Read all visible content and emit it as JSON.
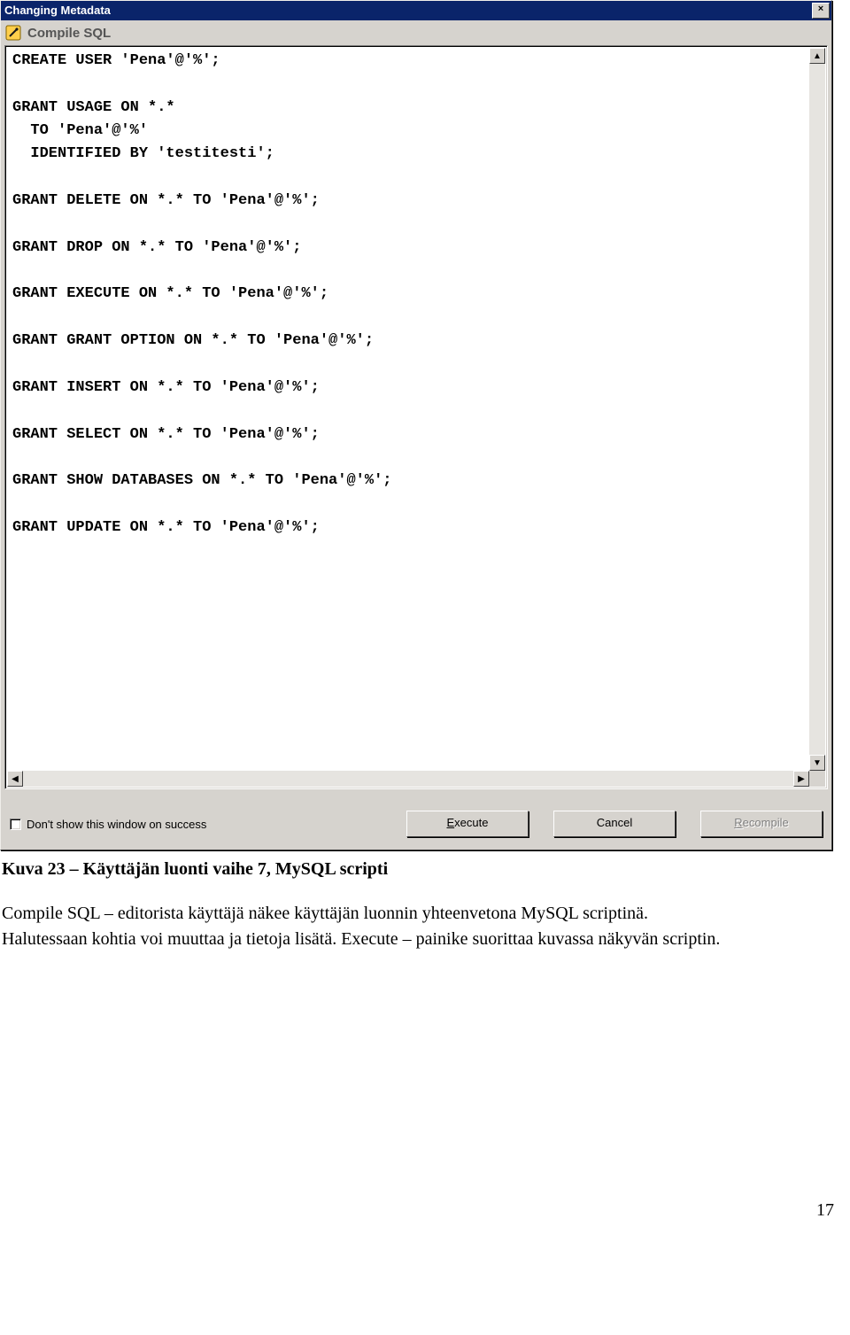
{
  "dialog": {
    "title": "Changing Metadata",
    "subtitle": "Compile SQL",
    "close_label": "×",
    "sql_lines": [
      "CREATE USER 'Pena'@'%';",
      "",
      "GRANT USAGE ON *.*",
      "  TO 'Pena'@'%'",
      "  IDENTIFIED BY 'testitesti';",
      "",
      "GRANT DELETE ON *.* TO 'Pena'@'%';",
      "",
      "GRANT DROP ON *.* TO 'Pena'@'%';",
      "",
      "GRANT EXECUTE ON *.* TO 'Pena'@'%';",
      "",
      "GRANT GRANT OPTION ON *.* TO 'Pena'@'%';",
      "",
      "GRANT INSERT ON *.* TO 'Pena'@'%';",
      "",
      "GRANT SELECT ON *.* TO 'Pena'@'%';",
      "",
      "GRANT SHOW DATABASES ON *.* TO 'Pena'@'%';",
      "",
      "GRANT UPDATE ON *.* TO 'Pena'@'%';"
    ],
    "checkbox_label": "Don't show this window on success",
    "buttons": {
      "execute_u": "E",
      "execute_rest": "xecute",
      "cancel": "Cancel",
      "recompile_u": "R",
      "recompile_rest": "ecompile"
    }
  },
  "caption": "Kuva 23 – Käyttäjän luonti vaihe 7, MySQL scripti",
  "body_text": "Compile SQL – editorista käyttäjä näkee käyttäjän luonnin yhteenvetona MySQL scriptinä. Halutessaan kohtia voi muuttaa ja tietoja lisätä. Execute – painike suorittaa kuvassa näkyvän scriptin.",
  "page_number": "17"
}
